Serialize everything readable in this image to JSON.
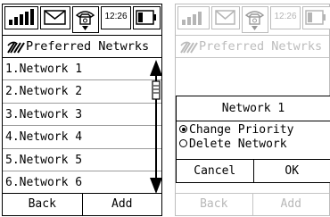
{
  "status": {
    "time": "12:26"
  },
  "title": "Preferred Netwrks",
  "networks": [
    "1.Network 1",
    "2.Network 2",
    "3.Network 3",
    "4.Network 4",
    "5.Network 5",
    "6.Network 6"
  ],
  "softkeys": {
    "left": "Back",
    "right": "Add"
  },
  "dialog": {
    "title": "Network 1",
    "options": [
      "Change Priority",
      "Delete Network"
    ],
    "selected_option": "Change Priority",
    "cancel": "Cancel",
    "ok": "OK"
  }
}
